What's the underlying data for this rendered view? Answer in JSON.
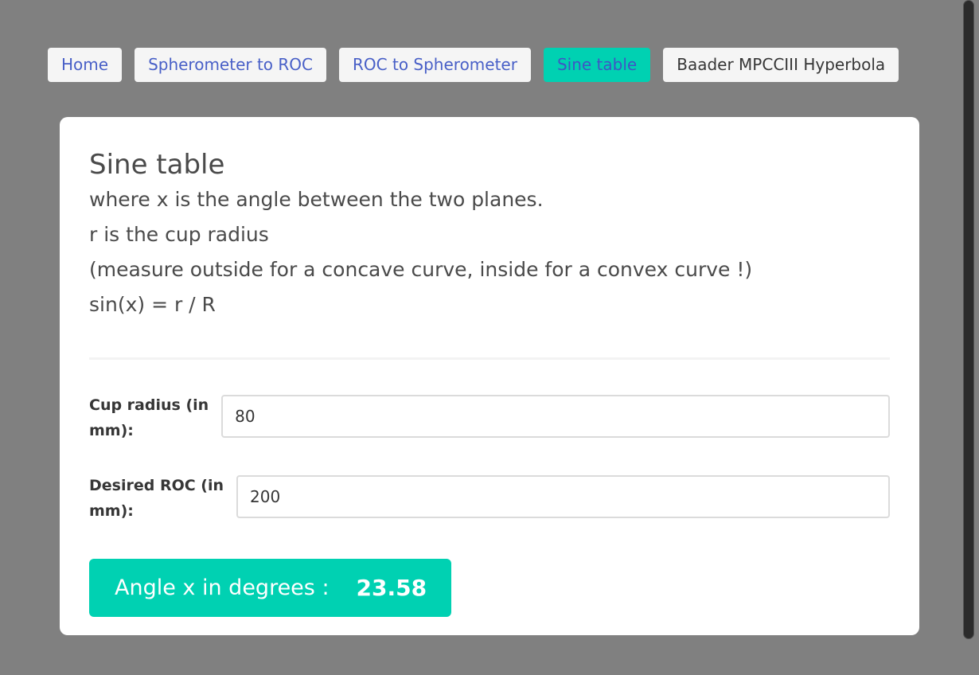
{
  "nav": {
    "items": [
      {
        "label": "Home"
      },
      {
        "label": "Spherometer to ROC"
      },
      {
        "label": "ROC to Spherometer"
      },
      {
        "label": "Sine table",
        "active": true
      },
      {
        "label": "Baader MPCCIII Hyperbola"
      }
    ]
  },
  "card": {
    "title": "Sine table",
    "lines": [
      "where x is the angle between the two planes.",
      "r is the cup radius",
      "(measure outside for a concave curve, inside for a convex curve !)",
      "sin(x) = r / R"
    ]
  },
  "form": {
    "cup_radius": {
      "label_line1": "Cup radius (in",
      "label_line2": "mm):",
      "value": "80"
    },
    "desired_roc": {
      "label_line1": "Desired ROC (in",
      "label_line2": "mm):",
      "value": "200"
    }
  },
  "result": {
    "label": "Angle x in degrees :",
    "value": "23.58"
  },
  "colors": {
    "background": "#808080",
    "accent": "#00d1b2",
    "link": "#485fc7"
  }
}
